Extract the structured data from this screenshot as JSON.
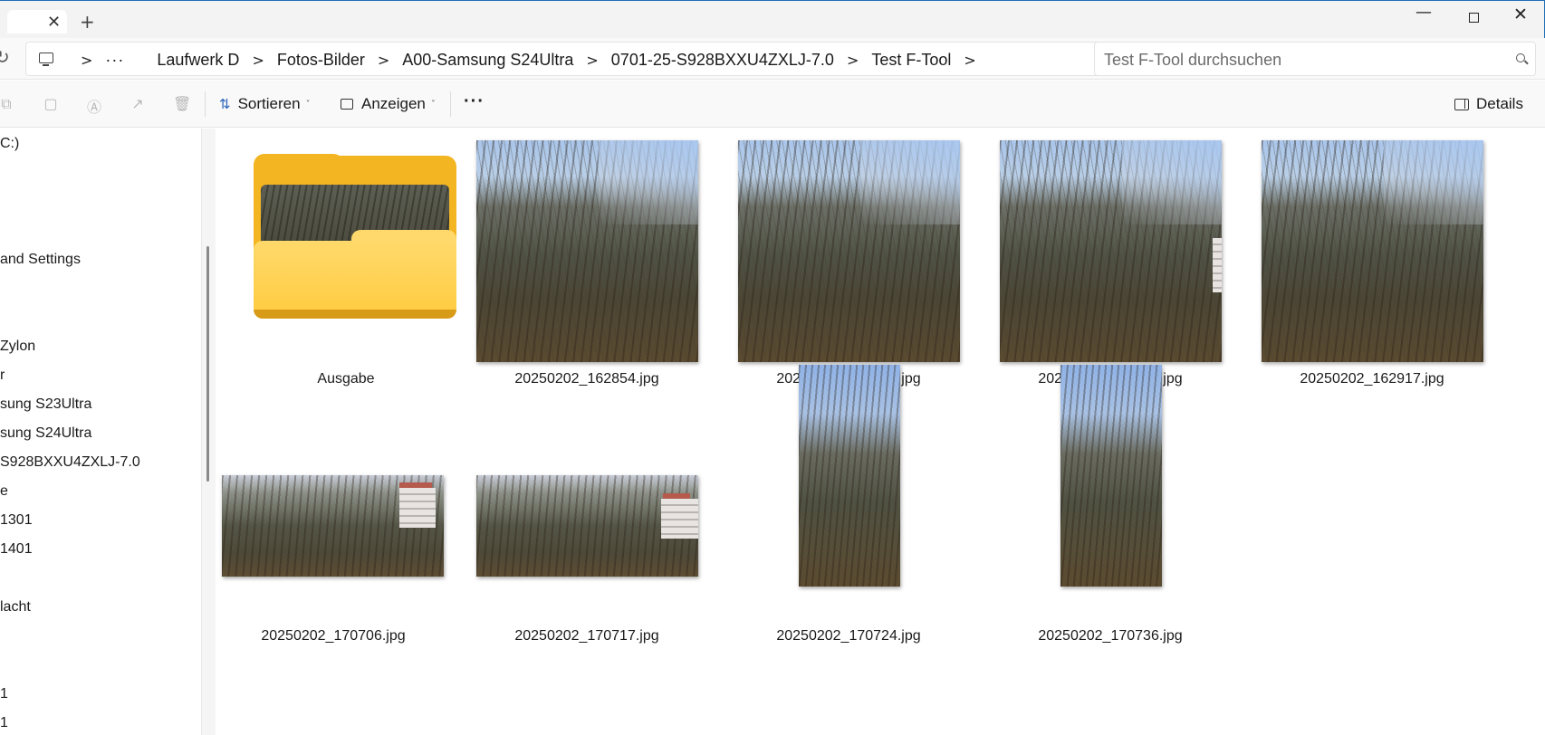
{
  "titlebar": {
    "close_tab_glyph": "✕",
    "new_tab_glyph": "+",
    "minimize_glyph": "—",
    "close_glyph": "✕"
  },
  "address": {
    "overflow": "···",
    "crumbs": [
      "Laufwerk D",
      "Fotos-Bilder",
      "A00-Samsung S24Ultra",
      "0701-25-S928BXXU4ZXLJ-7.0",
      "Test F-Tool"
    ],
    "separator": ">",
    "search_placeholder": "Test F-Tool durchsuchen"
  },
  "commandbar": {
    "sort_label": "Sortieren",
    "view_label": "Anzeigen",
    "more_label": "···",
    "details_label": "Details",
    "icons": [
      "copy-icon",
      "paste-icon",
      "rename-icon",
      "share-icon",
      "delete-icon"
    ]
  },
  "sidebar": {
    "items": [
      "C:)",
      "and Settings",
      "Zylon",
      "r",
      "sung S23Ultra",
      "sung S24Ultra",
      "S928BXXU4ZXLJ-7.0",
      "e",
      "1301",
      "1401",
      "lacht",
      "1",
      "1"
    ]
  },
  "files": {
    "folder": "Ausgabe",
    "images": [
      "20250202_162854.jpg",
      "20250202_162858.jpg",
      "20250202_162904.jpg",
      "20250202_162917.jpg",
      "20250202_170706.jpg",
      "20250202_170717.jpg",
      "20250202_170724.jpg",
      "20250202_170736.jpg"
    ]
  },
  "colors": {
    "accent": "#2a63b8",
    "folder_yellow": "#f3b521",
    "window_border": "#1f6fb5"
  }
}
